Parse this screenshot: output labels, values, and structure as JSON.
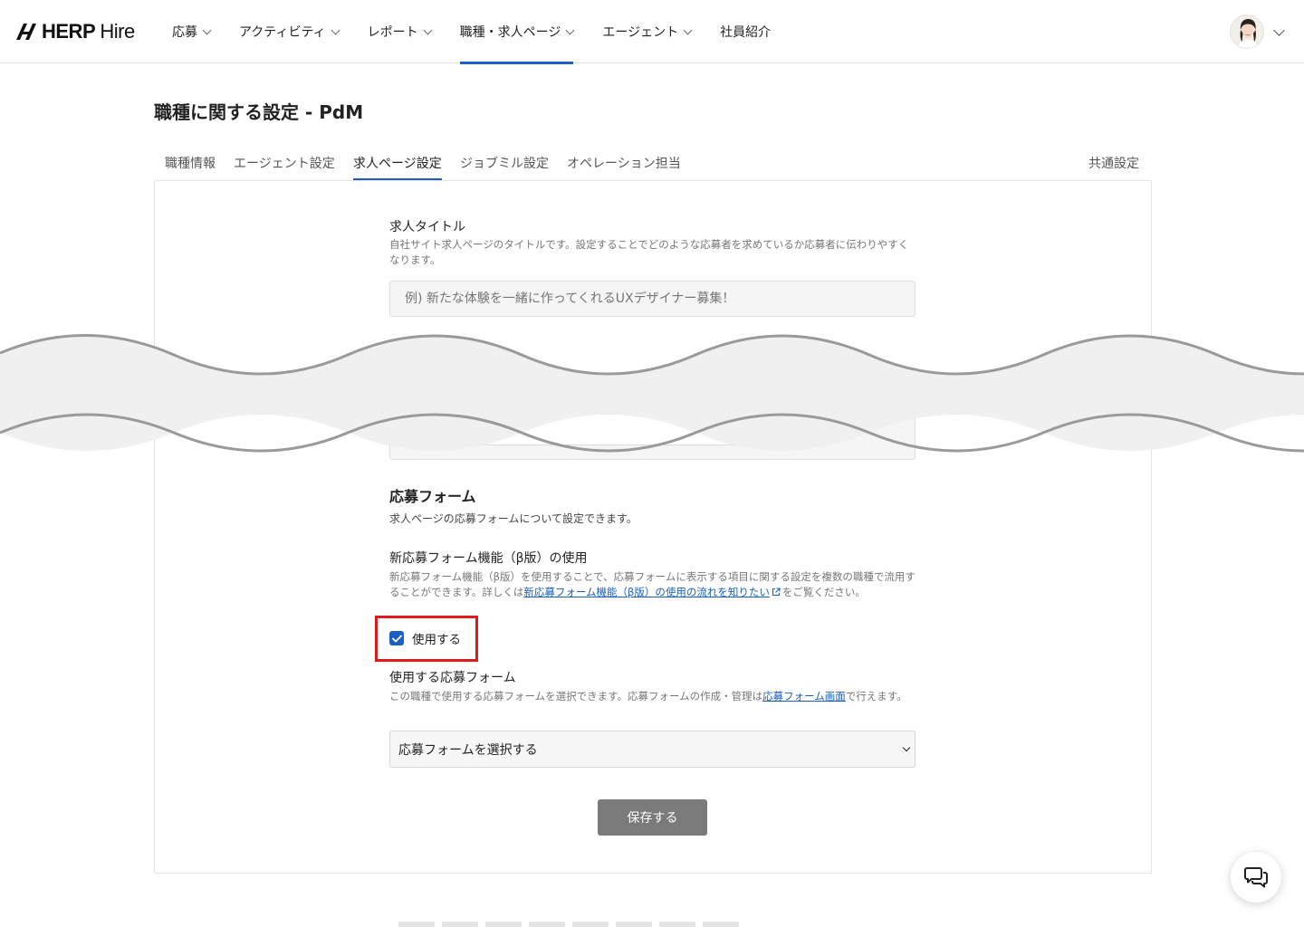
{
  "brand": {
    "name_bold": "HERP",
    "name_light": "Hire"
  },
  "nav": {
    "items": [
      {
        "label": "応募",
        "has_menu": true,
        "active": false
      },
      {
        "label": "アクティビティ",
        "has_menu": true,
        "active": false
      },
      {
        "label": "レポート",
        "has_menu": true,
        "active": false
      },
      {
        "label": "職種・求人ページ",
        "has_menu": true,
        "active": true
      },
      {
        "label": "エージェント",
        "has_menu": true,
        "active": false
      },
      {
        "label": "社員紹介",
        "has_menu": false,
        "active": false
      }
    ]
  },
  "page": {
    "title": "職種に関する設定 - PdM"
  },
  "tabs": [
    {
      "label": "職種情報",
      "active": false
    },
    {
      "label": "エージェント設定",
      "active": false
    },
    {
      "label": "求人ページ設定",
      "active": true
    },
    {
      "label": "ジョブミル設定",
      "active": false
    },
    {
      "label": "オペレーション担当",
      "active": false
    }
  ],
  "common_settings_tab": "共通設定",
  "job_title_field": {
    "label": "求人タイトル",
    "description": "自社サイト求人ページのタイトルです。設定することでどのような応募者を求めているか応募者に伝わりやすくなります。",
    "placeholder": "例) 新たな体験を一緒に作ってくれるUXデザイナー募集！"
  },
  "application_form": {
    "title": "応募フォーム",
    "description": "求人ページの応募フォームについて設定できます。",
    "beta_label": "新応募フォーム機能（β版）の使用",
    "beta_desc_before": "新応募フォーム機能（β版）を使用することで、応募フォームに表示する項目に関する設定を複数の職種で流用することができます。詳しくは",
    "beta_desc_link": "新応募フォーム機能（β版）の使用の流れを知りたい",
    "beta_desc_after": "をご覧ください。",
    "use_checkbox_label": "使用する",
    "use_checkbox_checked": true,
    "form_select_label": "使用する応募フォーム",
    "form_select_desc_before": "この職種で使用する応募フォームを選択できます。応募フォームの作成・管理は",
    "form_select_desc_link": "応募フォーム画面",
    "form_select_desc_after": "で行えます。",
    "form_select_value": "応募フォームを選択する"
  },
  "save_button": "保存する",
  "colors": {
    "accent": "#1b5fc1",
    "highlight": "#e01919",
    "button_disabled": "#7a7a7a"
  },
  "icons": [
    "logo-mark-icon",
    "chevron-down-icon",
    "check-icon",
    "external-link-icon",
    "chat-icon"
  ]
}
